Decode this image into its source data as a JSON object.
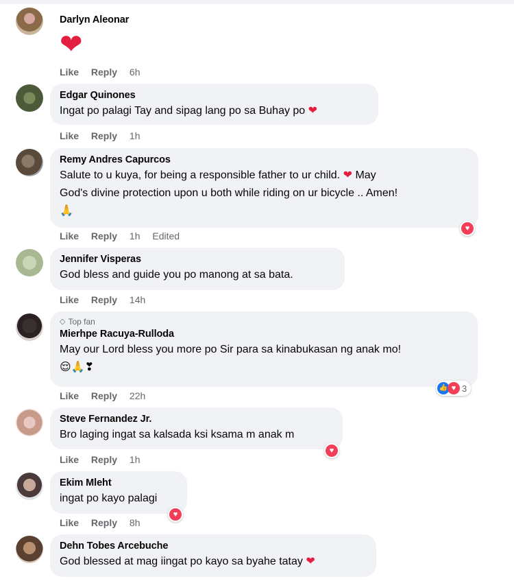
{
  "colors": {
    "bubble": "#f0f2f5",
    "heart": "#f33e58",
    "like": "#1877f2",
    "meta": "#65676b",
    "text": "#050505"
  },
  "actions": {
    "like": "Like",
    "reply": "Reply"
  },
  "comments": [
    {
      "name": "Darlyn Aleonar",
      "text": "❤",
      "time": "6h"
    },
    {
      "name": "Edgar Quinones",
      "text": "Ingat po palagi Tay and sipag lang po sa Buhay po",
      "emoji": "❤",
      "time": "1h"
    },
    {
      "name": "Remy Andres Capurcos",
      "text_line1": "Salute to u kuya, for being a responsible father to ur child.",
      "emoji_mid": "❤",
      "text_line1b": "May",
      "text_line2": "God's divine protection upon u both while riding on ur bicycle .. Amen!",
      "text_line3": "🙏",
      "time": "1h",
      "edited": "Edited",
      "reaction_icon": "heart-icon"
    },
    {
      "name": "Jennifer Visperas",
      "text": "God bless and guide you po manong at sa bata.",
      "time": "14h"
    },
    {
      "badge": "Top fan",
      "name": "Mierhpe Racuya-Rulloda",
      "text_line1": "May our Lord bless you more po Sir para sa kinabukasan ng anak mo!",
      "text_line2": "😌🙏❣",
      "time": "22h",
      "reaction_count": "3"
    },
    {
      "name": "Steve Fernandez Jr.",
      "text": "Bro laging ingat sa kalsada ksi ksama m anak m",
      "time": "1h"
    },
    {
      "name": "Ekim Mleht",
      "text": "ingat po kayo palagi",
      "time": "8h"
    },
    {
      "name": "Dehn Tobes Arcebuche",
      "text": "God blessed at mag iingat po kayo sa byahe tatay",
      "emoji": "❤"
    }
  ]
}
